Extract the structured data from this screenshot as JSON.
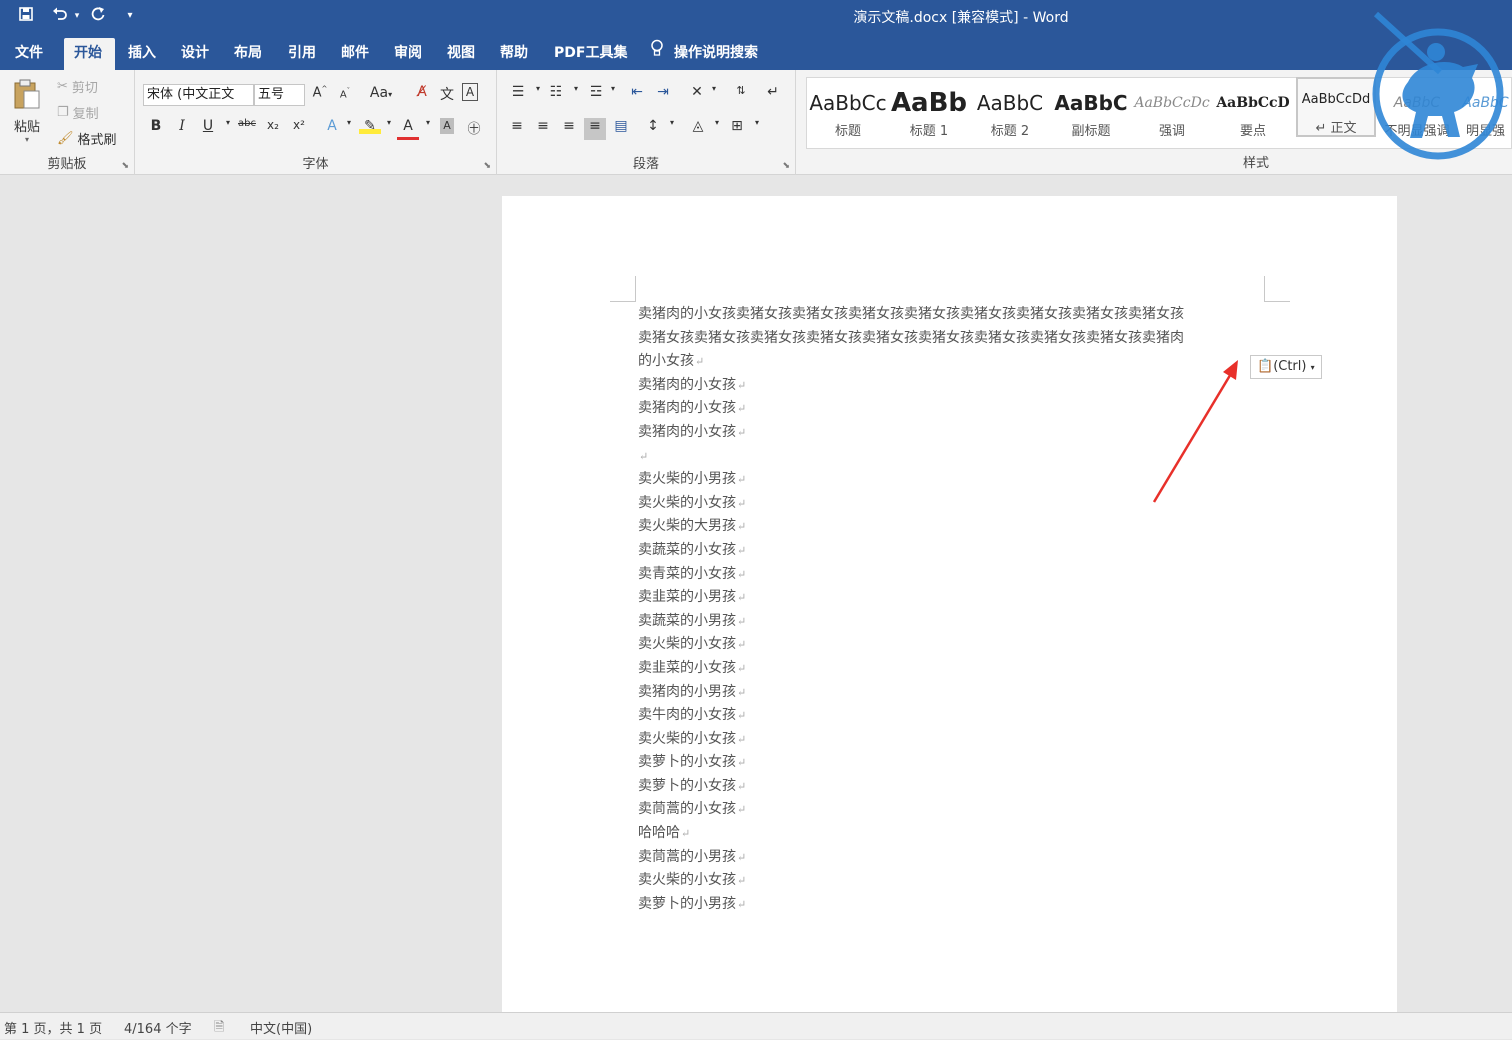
{
  "window": {
    "title": "演示文稿.docx [兼容模式]  -  Word"
  },
  "quick_access": {
    "save_icon": "save-icon",
    "undo_icon": "undo-icon",
    "redo_icon": "redo-icon",
    "customize_icon": "customize-qat-icon"
  },
  "tabs": [
    {
      "label": "文件"
    },
    {
      "label": "开始"
    },
    {
      "label": "插入"
    },
    {
      "label": "设计"
    },
    {
      "label": "布局"
    },
    {
      "label": "引用"
    },
    {
      "label": "邮件"
    },
    {
      "label": "审阅"
    },
    {
      "label": "视图"
    },
    {
      "label": "帮助"
    },
    {
      "label": "PDF工具集"
    }
  ],
  "active_tab": "开始",
  "tell_me": "操作说明搜索",
  "clipboard": {
    "group_label": "剪贴板",
    "paste": "粘贴",
    "cut": "剪切",
    "copy": "复制",
    "format_painter": "格式刷"
  },
  "font": {
    "group_label": "字体",
    "font_name": "宋体 (中文正文",
    "font_size": "五号",
    "bold": "B",
    "italic": "I",
    "underline": "U",
    "strike": "abc",
    "subscript": "x₂",
    "superscript": "x²",
    "case": "Aa",
    "grow": "A",
    "shrink": "A"
  },
  "paragraph": {
    "group_label": "段落"
  },
  "styles": {
    "group_label": "样式",
    "items": [
      {
        "preview": "AaBbCc",
        "name": "标题"
      },
      {
        "preview": "AaBb",
        "name": "标题 1"
      },
      {
        "preview": "AaBbC",
        "name": "标题 2"
      },
      {
        "preview": "AaBbC",
        "name": "副标题"
      },
      {
        "preview": "AaBbCcDc",
        "name": "强调"
      },
      {
        "preview": "AaBbCcD",
        "name": "要点"
      },
      {
        "preview": "AaBbCcDd",
        "name": "↵ 正文"
      },
      {
        "preview": "AaBbC",
        "name": "不明显强调"
      },
      {
        "preview": "AaBbC",
        "name": "明显强"
      }
    ]
  },
  "document": {
    "lines": [
      "卖猪肉的小女孩卖猪女孩卖猪女孩卖猪女孩卖猪女孩卖猪女孩卖猪女孩卖猪女孩卖猪女孩",
      "卖猪女孩卖猪女孩卖猪女孩卖猪女孩卖猪女孩卖猪女孩卖猪女孩卖猪女孩卖猪女孩卖猪肉",
      "的小女孩",
      "卖猪肉的小女孩",
      "卖猪肉的小女孩",
      "卖猪肉的小女孩",
      "",
      "卖火柴的小男孩",
      "卖火柴的小女孩",
      "卖火柴的大男孩",
      "卖蔬菜的小女孩",
      "卖青菜的小女孩",
      "卖韭菜的小男孩",
      "卖蔬菜的小男孩",
      "卖火柴的小女孩",
      "卖韭菜的小女孩",
      "卖猪肉的小男孩",
      "卖牛肉的小女孩",
      "卖火柴的小女孩",
      "卖萝卜的小女孩",
      "卖萝卜的小女孩",
      "卖茼蒿的小女孩",
      "哈哈哈",
      "卖茼蒿的小男孩",
      "卖火柴的小女孩",
      "卖萝卜的小男孩"
    ],
    "paragraph_mark": "↵",
    "paste_options": "(Ctrl)"
  },
  "status_bar": {
    "page": "第 1 页，共 1 页",
    "words": "4/164 个字",
    "language": "中文(中国)"
  },
  "colors": {
    "accent": "#2b579a",
    "annotation_arrow": "#e8302a",
    "logo": "#2f86d6"
  }
}
